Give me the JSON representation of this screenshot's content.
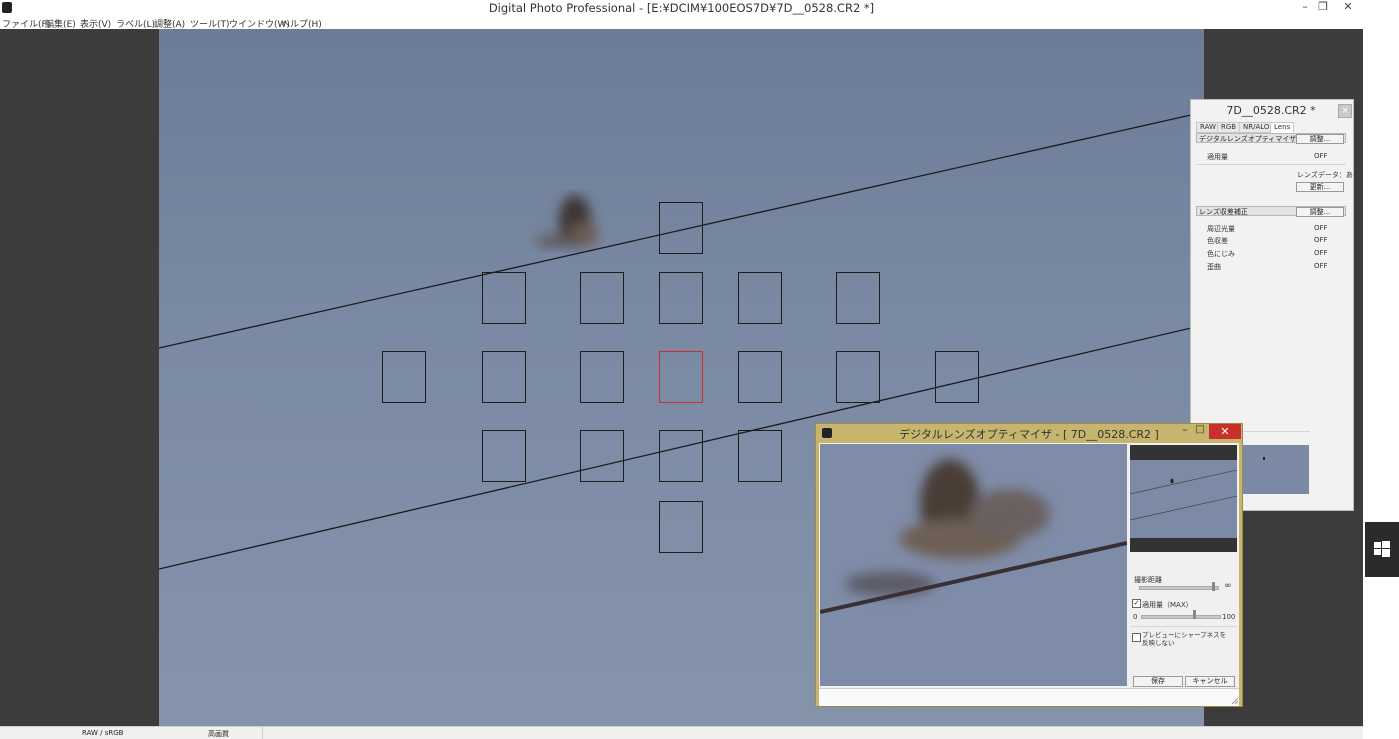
{
  "window": {
    "title": "Digital Photo Professional - [E:¥DCIM¥100EOS7D¥7D__0528.CR2 *]",
    "min_glyph": "–",
    "max_glyph": "❐",
    "close_glyph": "✕"
  },
  "menu": [
    "ファイル(F)",
    "編集(E)",
    "表示(V)",
    "ラベル(L)",
    "調整(A)",
    "ツール(T)",
    "ウインドウ(W)",
    "ヘルプ(H)"
  ],
  "status": {
    "colorspace": "RAW / sRGB",
    "quality": "高画質"
  },
  "colors": {
    "selected_af_point": "#d12b2b",
    "dialog_frame": "#c7b56e",
    "close_button": "#c7302b"
  },
  "af_points": {
    "count": 19,
    "selected_index": 10
  },
  "palette": {
    "title": "7D__0528.CR2 *",
    "close_glyph": "×",
    "tabs": [
      "RAW",
      "RGB",
      "NR/ALO",
      "Lens"
    ],
    "active_tab": "Lens",
    "dlo_section": "デジタルレンズオプティマイザ",
    "adjust_button": "調整...",
    "amount_label": "適用量",
    "amount_value": "OFF",
    "lens_data": "レンズデータ：あり",
    "update_button": "更新...",
    "aberration_section": "レンズ収差補正",
    "aberration_button": "調整...",
    "items": [
      {
        "label": "周辺光量",
        "value": "OFF"
      },
      {
        "label": "色収差",
        "value": "OFF"
      },
      {
        "label": "色にじみ",
        "value": "OFF"
      },
      {
        "label": "歪曲",
        "value": "OFF"
      }
    ]
  },
  "dialog": {
    "title": "デジタルレンズオプティマイザ - [ 7D__0528.CR2 ]",
    "min_glyph": "–",
    "max_glyph": "□",
    "close_glyph": "✕",
    "distance_label": "撮影距離",
    "infinity": "∞",
    "amount_check": "適用量（MAX）",
    "amount_checked": true,
    "slider_min": "0",
    "slider_max": "100",
    "sharpness_check": "プレビューにシャープネスを反映しない",
    "sharpness_checked": false,
    "save_button": "保存",
    "cancel_button": "キャンセル"
  }
}
